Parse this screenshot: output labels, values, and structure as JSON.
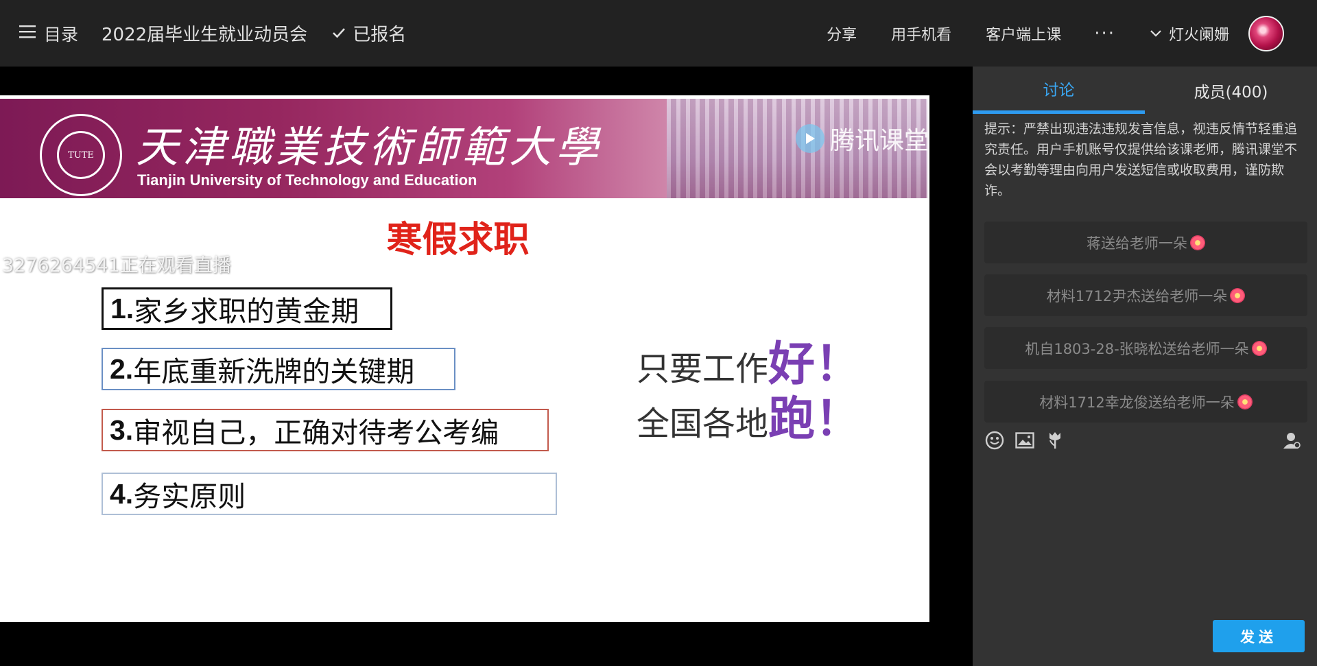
{
  "topbar": {
    "menu_label": "目录",
    "course_title": "2022届毕业生就业动员会",
    "enrolled_label": "已报名",
    "share_label": "分享",
    "mobile_label": "用手机看",
    "client_label": "客户端上课",
    "more_label": "···",
    "username": "灯火阑姗"
  },
  "slide": {
    "university_cn": "天津職業技術師範大學",
    "university_en": "Tianjin University of Technology and Education",
    "emblem_text": "TUTE",
    "watermark": "腾讯课堂",
    "title": "寒假求职",
    "viewer_tip": "3276264541正在观看直播",
    "points": [
      {
        "num": "1.",
        "text": "家乡求职的黄金期"
      },
      {
        "num": "2.",
        "text": "年底重新洗牌的关键期"
      },
      {
        "num": "3.",
        "text": "审视自己，正确对待考公考编"
      },
      {
        "num": "4.",
        "text": "务实原则"
      }
    ],
    "slogan_1": {
      "text": "只要工作",
      "emphasis": "好！"
    },
    "slogan_2": {
      "text": "全国各地",
      "emphasis": "跑！"
    }
  },
  "panel": {
    "tabs": [
      {
        "label": "讨论",
        "active": true
      },
      {
        "label": "成员(400)",
        "active": false
      }
    ],
    "notice": "提示：严禁出现违法违规发言信息，视违反情节轻重追究责任。用户手机账号仅提供给该课老师，腾讯课堂不会以考勤等理由向用户发送短信或收取费用，谨防欺诈。",
    "gifts": [
      "蒋送给老师一朵",
      "材料1712尹杰送给老师一朵",
      "机自1803-28-张晓松送给老师一朵",
      "材料1712幸龙俊送给老师一朵"
    ],
    "toolbar_icons": [
      "emoji-icon",
      "image-icon",
      "flower-icon",
      "user-icon"
    ],
    "send_label": "发送"
  },
  "colors": {
    "accent": "#2e9bf0",
    "send_button": "#1fa0ec",
    "slide_title": "#e0231a",
    "slogan_emphasis": "#7a3fb3",
    "topbar_bg": "#222222",
    "panel_bg": "#333333"
  }
}
